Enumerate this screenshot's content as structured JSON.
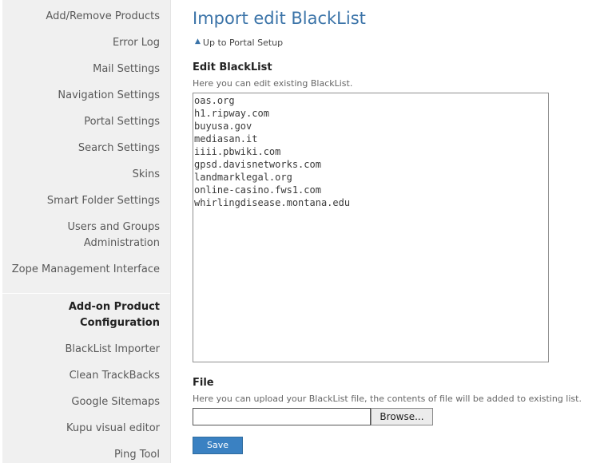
{
  "sidebar": {
    "items": [
      {
        "label": "Add/Remove Products"
      },
      {
        "label": "Error Log"
      },
      {
        "label": "Mail Settings"
      },
      {
        "label": "Navigation Settings"
      },
      {
        "label": "Portal Settings"
      },
      {
        "label": "Search Settings"
      },
      {
        "label": "Skins"
      },
      {
        "label": "Smart Folder Settings"
      },
      {
        "label": "Users and Groups",
        "label2": "Administration"
      },
      {
        "label": "Zope Management Interface"
      }
    ],
    "section": {
      "line1": "Add-on Product",
      "line2": "Configuration"
    },
    "addon_items": [
      {
        "label": "BlackList Importer"
      },
      {
        "label": "Clean TrackBacks"
      },
      {
        "label": "Google Sitemaps"
      },
      {
        "label": "Kupu visual editor"
      },
      {
        "label": "Ping Tool"
      }
    ]
  },
  "page": {
    "title": "Import edit BlackList",
    "up_link": "Up to Portal Setup"
  },
  "edit": {
    "label": "Edit BlackList",
    "help": "Here you can edit existing BlackList.",
    "lines": [
      "oas.org",
      "h1.ripway.com",
      "buyusa.gov",
      "mediasan.it",
      "iiii.pbwiki.com",
      "gpsd.davisnetworks.com",
      "landmarklegal.org",
      "online-casino.fws1.com",
      "whirlingdisease.montana.edu"
    ]
  },
  "file": {
    "label": "File",
    "help": "Here you can upload your BlackList file, the contents of file will be added to existing list.",
    "value": "",
    "browse_label": "Browse..."
  },
  "actions": {
    "save_label": "Save"
  },
  "colors": {
    "accent": "#3a73a8",
    "sidebar_bg": "#f0f0f0",
    "save_button": "#3a81c2"
  }
}
